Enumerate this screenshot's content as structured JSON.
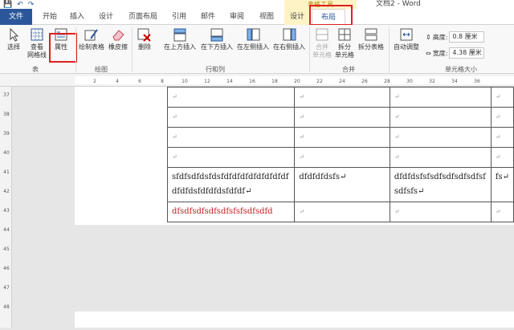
{
  "window": {
    "context_group": "表格工具",
    "title": "文档2 - Word"
  },
  "qat": {
    "save": "💾",
    "undo": "↶",
    "redo": "↷"
  },
  "tabs": [
    "文件",
    "开始",
    "插入",
    "设计",
    "页面布局",
    "引用",
    "邮件",
    "审阅",
    "视图",
    "设计",
    "布局"
  ],
  "ribbon": {
    "select": "选择",
    "gridlines": "查看\n网格线",
    "properties": "属性",
    "draw_table": "绘制表格",
    "eraser": "橡皮擦",
    "delete": "删除",
    "insert_above": "在上方插入",
    "insert_below": "在下方插入",
    "insert_left": "在左侧插入",
    "insert_right": "在右侧插入",
    "merge_cells": "合并\n单元格",
    "split_cells": "拆分\n单元格",
    "split_table": "拆分表格",
    "autofit": "自动调整",
    "height_label": "高度:",
    "height_value": "0.8 厘米",
    "width_label": "宽度:",
    "width_value": "4.38 厘米",
    "groups": {
      "table": "表",
      "draw": "绘图",
      "rows_cols": "行和列",
      "merge": "合并",
      "cell_size": "单元格大小"
    }
  },
  "ruler_marks": [
    "2",
    "4",
    "6",
    "8",
    "10",
    "12",
    "14",
    "16",
    "18",
    "20",
    "22",
    "24",
    "26",
    "28",
    "30",
    "32",
    "34",
    "36"
  ],
  "vruler_marks": [
    "37",
    "38",
    "39",
    "40",
    "41",
    "42",
    "43",
    "44",
    "45",
    "46",
    "47",
    "48"
  ],
  "table": {
    "rows": [
      [
        "↵",
        "↵",
        "↵",
        "↵"
      ],
      [
        "↵",
        "↵",
        "↵",
        "↵"
      ],
      [
        "↵",
        "↵",
        "↵",
        "↵"
      ],
      [
        "↵",
        "↵",
        "↵",
        "↵"
      ],
      [
        "sfdfsdfdsfdsfdfdfdfdfdfdfdfdfdfdfdsfdfdfdsfdfdf↵",
        "dfdfdfdsfs↵",
        "dfdfdsfsfsdfsdfsdfsdfsfsdfsfs↵",
        "fs↵"
      ],
      [
        "dfsdfsdfsdfsdfsfsfsdfsdfd",
        "↵",
        "↵",
        "↵"
      ]
    ],
    "marks": {
      "cell_end": "↵"
    }
  }
}
